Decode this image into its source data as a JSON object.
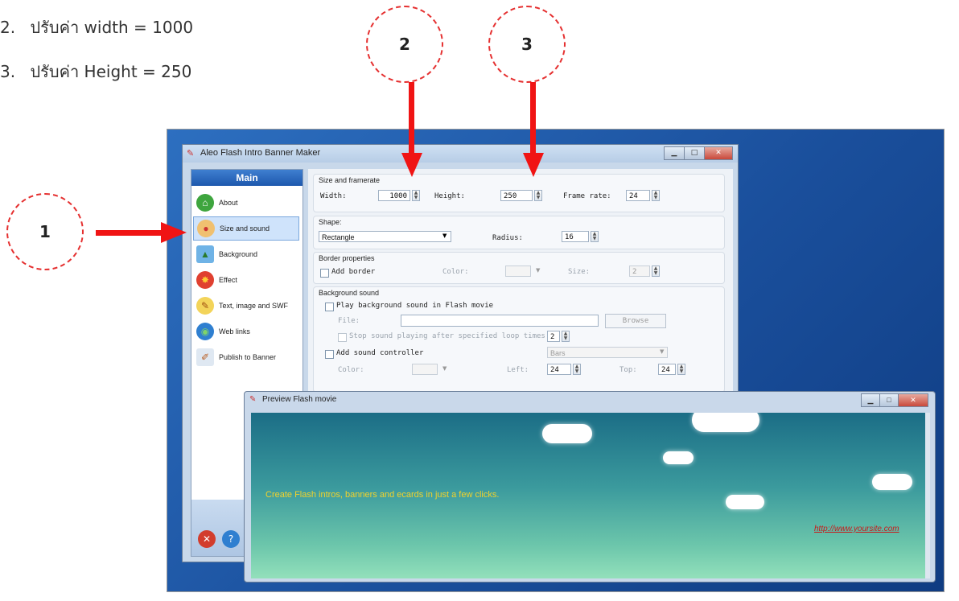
{
  "steps": [
    {
      "number": "2.",
      "text": "ปรับค่า width = 1000"
    },
    {
      "number": "3.",
      "text": "ปรับค่า Height = 250"
    }
  ],
  "callouts": {
    "one": "1",
    "two": "2",
    "three": "3"
  },
  "colors": {
    "arrow": "#f01414",
    "circle": "#e53030"
  },
  "app": {
    "title": "Aleo Flash Intro Banner Maker",
    "sidebar": {
      "header": "Main",
      "items": [
        {
          "label": "About",
          "icon": "home-icon"
        },
        {
          "label": "Size and sound",
          "icon": "palette-icon"
        },
        {
          "label": "Background",
          "icon": "picture-icon"
        },
        {
          "label": "Effect",
          "icon": "burst-icon"
        },
        {
          "label": "Text, image and SWF",
          "icon": "pencil-icon"
        },
        {
          "label": "Web links",
          "icon": "globe-icon"
        },
        {
          "label": "Publish to Banner",
          "icon": "brush-icon"
        }
      ],
      "selected": "Size and sound"
    },
    "size": {
      "title": "Size and framerate",
      "width_label": "Width:",
      "width": "1000",
      "height_label": "Height:",
      "height": "250",
      "fps_label": "Frame rate:",
      "fps": "24"
    },
    "shape": {
      "title": "Shape:",
      "value": "Rectangle",
      "radius_label": "Radius:",
      "radius": "16"
    },
    "border": {
      "title": "Border properties",
      "add_label": "Add border",
      "color_label": "Color:",
      "size_label": "Size:",
      "size": "2"
    },
    "sound": {
      "title": "Background sound",
      "play_label": "Play background sound in Flash movie",
      "file_label": "File:",
      "browse_label": "Browse",
      "stop_label": "Stop sound playing after specified loop times:",
      "loop": "2",
      "controller_label": "Add sound controller",
      "controller_value": "Bars",
      "color_label": "Color:",
      "left_label": "Left:",
      "left": "24",
      "top_label": "Top:",
      "top": "24"
    }
  },
  "preview": {
    "title": "Preview Flash movie",
    "tagline": "Create Flash intros, banners and ecards in just a few clicks.",
    "link": "http://www.yoursite.com"
  }
}
